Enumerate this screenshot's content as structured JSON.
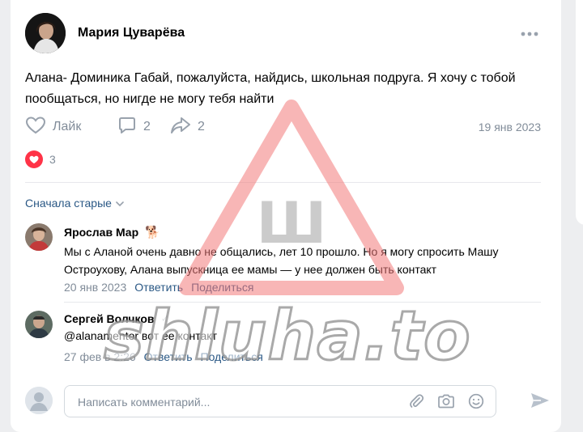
{
  "post": {
    "author": "Мария Цуварёва",
    "text": "Алана- Доминика Габай, пожалуйста, найдись, школьная подруга. Я хочу с тобой пообщаться, но нигде не могу тебя найти",
    "like_label": "Лайк",
    "comments_count": "2",
    "shares_count": "2",
    "date": "19 янв 2023",
    "reactions_count": "3"
  },
  "comments_sort": "Сначала старые",
  "comments": [
    {
      "author": "Ярослав Мар",
      "badge_emoji": "🐕",
      "text": "Мы с Аланой очень давно не общались, лет 10 прошло. Но я могу спросить Машу Остроухову, Алана выпускница ее мамы — у нее должен быть контакт",
      "date": "20 янв 2023",
      "reply_label": "Ответить",
      "share_label": "Поделиться"
    },
    {
      "author": "Сергей Волчков",
      "badge_emoji": "✓",
      "text": "@alanamentor вот ее контакт",
      "date": "27 фев в 2:26",
      "reply_label": "Ответить",
      "share_label": "Поделиться"
    }
  ],
  "comment_input": {
    "placeholder": "Написать комментарий..."
  },
  "watermark": {
    "text": "shluha.to",
    "sign_letter": "Ш"
  },
  "colors": {
    "link": "#2a5885",
    "muted": "#818c99",
    "heart": "#ff3347",
    "watermark_red": "#f27a7a"
  }
}
